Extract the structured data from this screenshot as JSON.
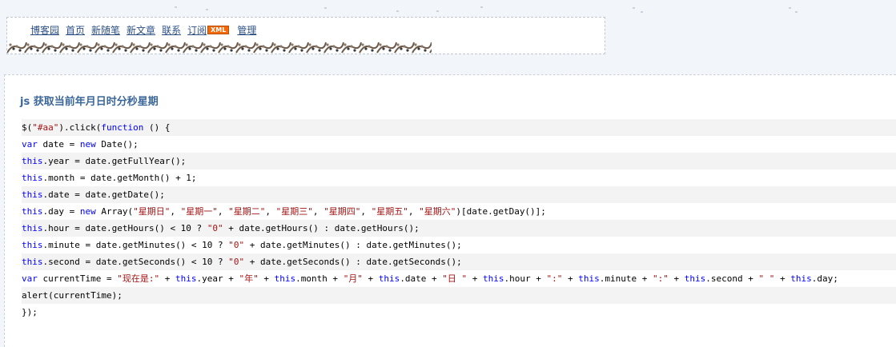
{
  "header": {
    "nav": [
      {
        "id": "blog-home",
        "label": "博客园"
      },
      {
        "id": "home",
        "label": "首页"
      },
      {
        "id": "new-post",
        "label": "新随笔"
      },
      {
        "id": "new-article",
        "label": "新文章"
      },
      {
        "id": "contact",
        "label": "联系"
      },
      {
        "id": "subscribe",
        "label": "订阅"
      },
      {
        "id": "manage",
        "label": "管理"
      }
    ],
    "xml_badge": "XML"
  },
  "post": {
    "title": "js 获取当前年月日时分秒星期"
  },
  "code": {
    "keyword_color": "#0000ff",
    "string_color": "#a31515",
    "lines": [
      [
        [
          "t",
          "$("
        ],
        [
          "s",
          "\"#aa\""
        ],
        [
          "t",
          ").click("
        ],
        [
          "k",
          "function"
        ],
        [
          "t",
          " () {"
        ]
      ],
      [
        [
          "k",
          "var"
        ],
        [
          "t",
          " date = "
        ],
        [
          "k",
          "new"
        ],
        [
          "t",
          " Date();"
        ]
      ],
      [
        [
          "k",
          "this"
        ],
        [
          "t",
          ".year = date.getFullYear();"
        ]
      ],
      [
        [
          "k",
          "this"
        ],
        [
          "t",
          ".month = date.getMonth() + 1;"
        ]
      ],
      [
        [
          "k",
          "this"
        ],
        [
          "t",
          ".date = date.getDate();"
        ]
      ],
      [
        [
          "k",
          "this"
        ],
        [
          "t",
          ".day = "
        ],
        [
          "k",
          "new"
        ],
        [
          "t",
          " Array("
        ],
        [
          "s",
          "\"星期日\""
        ],
        [
          "t",
          ", "
        ],
        [
          "s",
          "\"星期一\""
        ],
        [
          "t",
          ", "
        ],
        [
          "s",
          "\"星期二\""
        ],
        [
          "t",
          ", "
        ],
        [
          "s",
          "\"星期三\""
        ],
        [
          "t",
          ", "
        ],
        [
          "s",
          "\"星期四\""
        ],
        [
          "t",
          ", "
        ],
        [
          "s",
          "\"星期五\""
        ],
        [
          "t",
          ", "
        ],
        [
          "s",
          "\"星期六\""
        ],
        [
          "t",
          ")[date.getDay()];"
        ]
      ],
      [
        [
          "k",
          "this"
        ],
        [
          "t",
          ".hour = date.getHours() < 10 ? "
        ],
        [
          "s",
          "\"0\""
        ],
        [
          "t",
          " + date.getHours() : date.getHours();"
        ]
      ],
      [
        [
          "k",
          "this"
        ],
        [
          "t",
          ".minute = date.getMinutes() < 10 ? "
        ],
        [
          "s",
          "\"0\""
        ],
        [
          "t",
          " + date.getMinutes() : date.getMinutes();"
        ]
      ],
      [
        [
          "k",
          "this"
        ],
        [
          "t",
          ".second = date.getSeconds() < 10 ? "
        ],
        [
          "s",
          "\"0\""
        ],
        [
          "t",
          " + date.getSeconds() : date.getSeconds();"
        ]
      ],
      [
        [
          "k",
          "var"
        ],
        [
          "t",
          " currentTime = "
        ],
        [
          "s",
          "\"现在是:\""
        ],
        [
          "t",
          " + "
        ],
        [
          "k",
          "this"
        ],
        [
          "t",
          ".year + "
        ],
        [
          "s",
          "\"年\""
        ],
        [
          "t",
          " + "
        ],
        [
          "k",
          "this"
        ],
        [
          "t",
          ".month + "
        ],
        [
          "s",
          "\"月\""
        ],
        [
          "t",
          " + "
        ],
        [
          "k",
          "this"
        ],
        [
          "t",
          ".date + "
        ],
        [
          "s",
          "\"日 \""
        ],
        [
          "t",
          " + "
        ],
        [
          "k",
          "this"
        ],
        [
          "t",
          ".hour + "
        ],
        [
          "s",
          "\":\""
        ],
        [
          "t",
          " + "
        ],
        [
          "k",
          "this"
        ],
        [
          "t",
          ".minute + "
        ],
        [
          "s",
          "\":\""
        ],
        [
          "t",
          " + "
        ],
        [
          "k",
          "this"
        ],
        [
          "t",
          ".second + "
        ],
        [
          "s",
          "\" \""
        ],
        [
          "t",
          " + "
        ],
        [
          "k",
          "this"
        ],
        [
          "t",
          ".day;"
        ]
      ],
      [
        [
          "t",
          "alert(currentTime);"
        ]
      ],
      [
        [
          "t",
          "});"
        ]
      ]
    ]
  }
}
